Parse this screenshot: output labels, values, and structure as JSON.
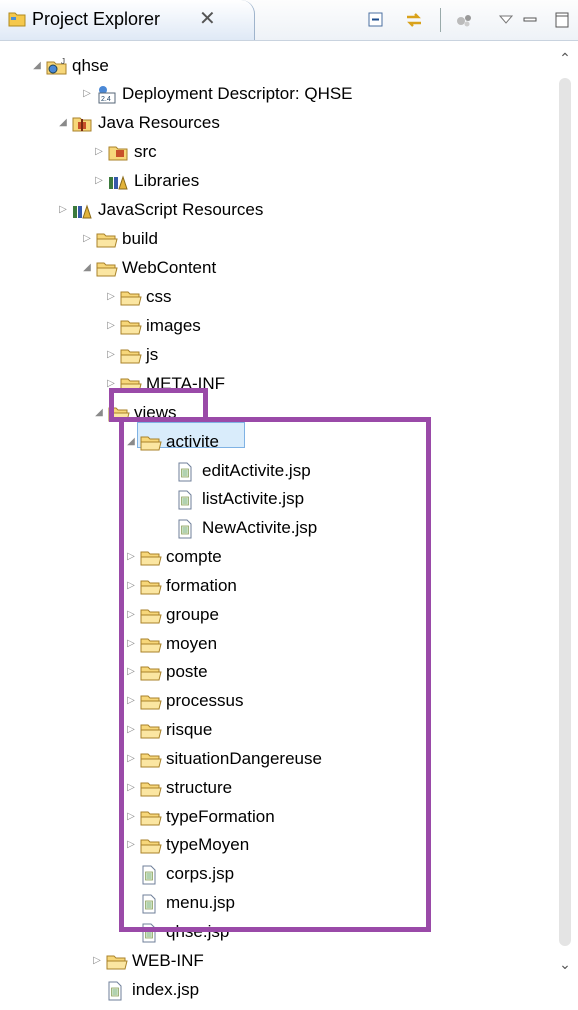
{
  "tab": {
    "title": "Project Explorer",
    "close": "✕"
  },
  "toolbar": [
    "collapse-all",
    "link-with-editor",
    "filters",
    "view-menu",
    "minimize",
    "maximize"
  ],
  "tree": {
    "items": [
      {
        "label": "qhse",
        "icon": "web-project-icon",
        "twisty": "open"
      },
      {
        "label": "Deployment Descriptor: QHSE",
        "icon": "deployment-descriptor-icon",
        "twisty": "closed"
      },
      {
        "label": "Java Resources",
        "icon": "java-resources-icon",
        "twisty": "open"
      },
      {
        "label": "src",
        "icon": "source-folder-icon",
        "twisty": "closed"
      },
      {
        "label": "Libraries",
        "icon": "libraries-icon",
        "twisty": "closed"
      },
      {
        "label": "JavaScript Resources",
        "icon": "libraries-icon",
        "twisty": "closed"
      },
      {
        "label": "build",
        "icon": "folder-icon",
        "twisty": "closed"
      },
      {
        "label": "WebContent",
        "icon": "folder-icon",
        "twisty": "open"
      },
      {
        "label": "css",
        "icon": "folder-icon",
        "twisty": "closed"
      },
      {
        "label": "images",
        "icon": "folder-icon",
        "twisty": "closed"
      },
      {
        "label": "js",
        "icon": "folder-icon",
        "twisty": "closed"
      },
      {
        "label": "META-INF",
        "icon": "folder-icon",
        "twisty": "closed"
      },
      {
        "label": "views",
        "icon": "folder-icon",
        "twisty": "open"
      },
      {
        "label": "activite",
        "icon": "folder-icon",
        "twisty": "open",
        "selected": true
      },
      {
        "label": "editActivite.jsp",
        "icon": "jsp-file-icon",
        "twisty": "none"
      },
      {
        "label": "listActivite.jsp",
        "icon": "jsp-file-icon",
        "twisty": "none"
      },
      {
        "label": "NewActivite.jsp",
        "icon": "jsp-file-icon",
        "twisty": "none"
      },
      {
        "label": "compte",
        "icon": "folder-icon",
        "twisty": "closed"
      },
      {
        "label": "formation",
        "icon": "folder-icon",
        "twisty": "closed"
      },
      {
        "label": "groupe",
        "icon": "folder-icon",
        "twisty": "closed"
      },
      {
        "label": "moyen",
        "icon": "folder-icon",
        "twisty": "closed"
      },
      {
        "label": "poste",
        "icon": "folder-icon",
        "twisty": "closed"
      },
      {
        "label": "processus",
        "icon": "folder-icon",
        "twisty": "closed"
      },
      {
        "label": "risque",
        "icon": "folder-icon",
        "twisty": "closed"
      },
      {
        "label": "situationDangereuse",
        "icon": "folder-icon",
        "twisty": "closed"
      },
      {
        "label": "structure",
        "icon": "folder-icon",
        "twisty": "closed"
      },
      {
        "label": "typeFormation",
        "icon": "folder-icon",
        "twisty": "closed"
      },
      {
        "label": "typeMoyen",
        "icon": "folder-icon",
        "twisty": "closed"
      },
      {
        "label": "corps.jsp",
        "icon": "jsp-file-icon",
        "twisty": "none"
      },
      {
        "label": "menu.jsp",
        "icon": "jsp-file-icon",
        "twisty": "none"
      },
      {
        "label": "qhse.jsp",
        "icon": "jsp-file-icon",
        "twisty": "none"
      },
      {
        "label": "WEB-INF",
        "icon": "folder-icon",
        "twisty": "closed"
      },
      {
        "label": "index.jsp",
        "icon": "jsp-file-icon",
        "twisty": "none"
      }
    ]
  },
  "scrollbar": {
    "up": "⌃",
    "down": "⌄"
  },
  "colors": {
    "highlight": "#9a4aa8",
    "selection": "#d9ecfb",
    "folder": "#f5c84c"
  }
}
